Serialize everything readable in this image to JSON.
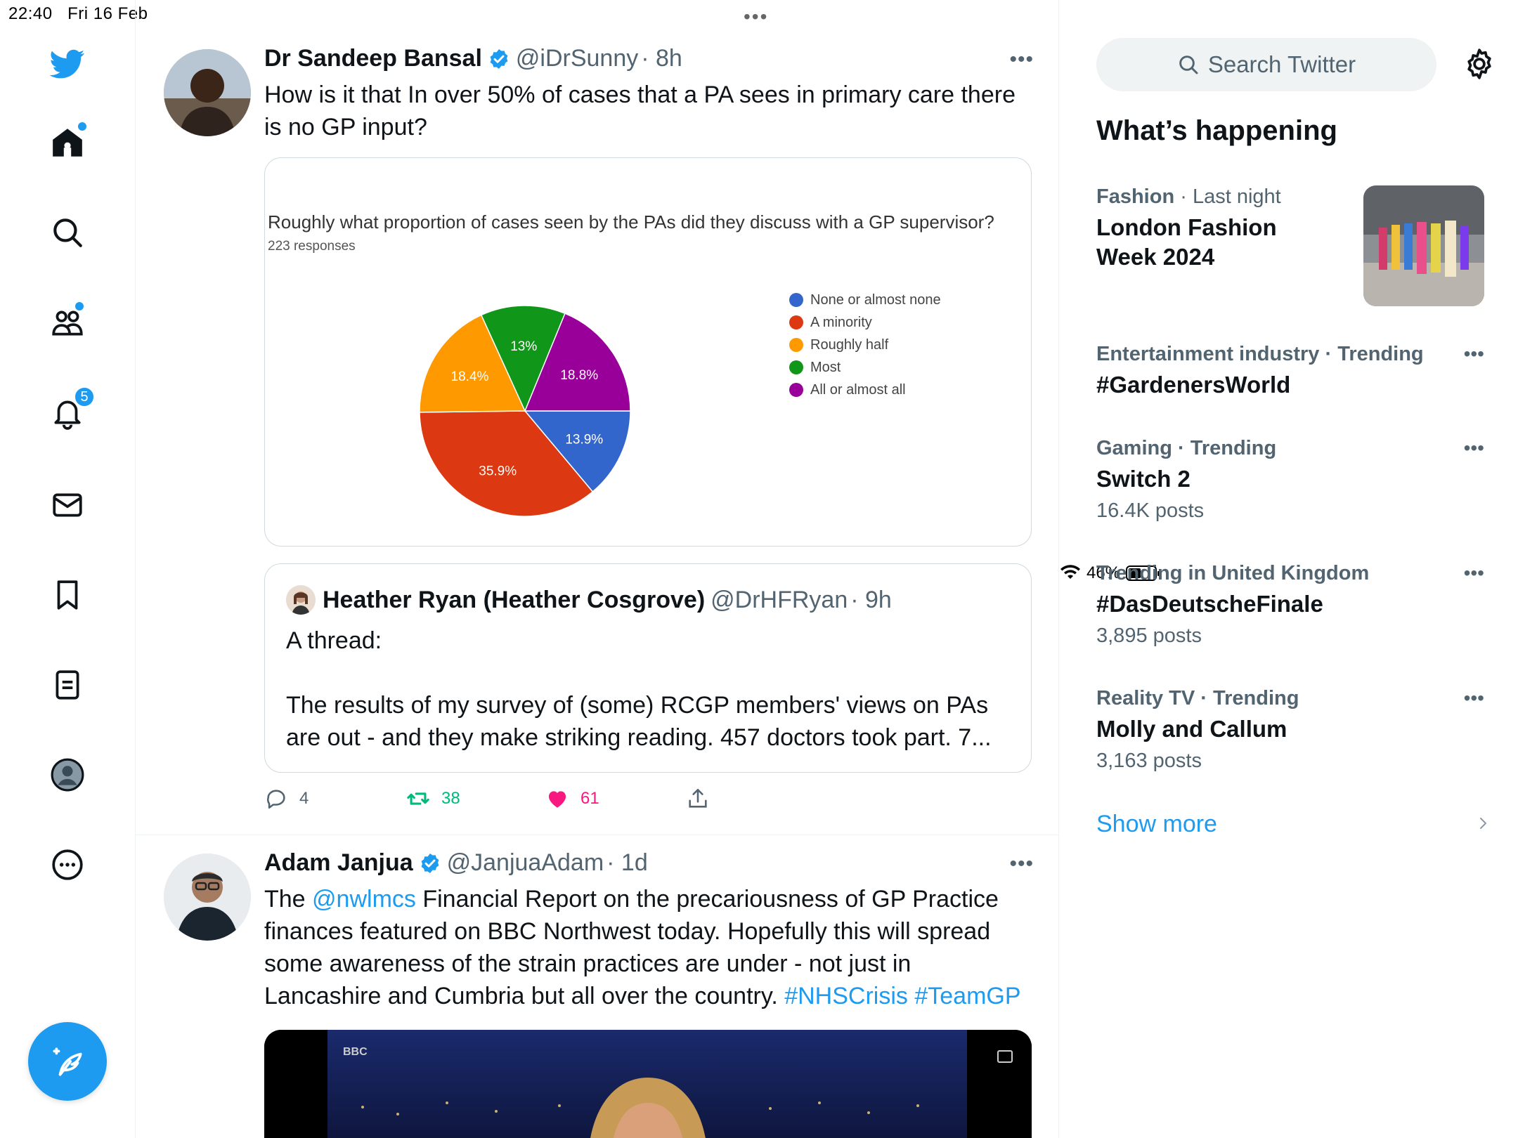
{
  "status_bar": {
    "time": "22:40",
    "date": "Fri 16 Feb",
    "battery": "46%",
    "battery_level": 0.46
  },
  "nav": {
    "notifications_badge": "5"
  },
  "tweets": [
    {
      "name": "Dr Sandeep Bansal",
      "handle": "@iDrSunny",
      "time": "· 8h",
      "text_line1": "How is it that In over 50% of cases that a PA sees in primary care there",
      "text_line2": "is no GP input?",
      "chart_title": "Roughly what proportion of cases seen by the PAs did they discuss with a GP supervisor?",
      "chart_subtitle": "223 responses",
      "quote": {
        "name": "Heather Ryan (Heather Cosgrove)",
        "handle": "@DrHFRyan",
        "time": "· 9h",
        "line1": "A thread:",
        "line2": "The results of my survey of (some) RCGP members' views on PAs",
        "line3": "are out - and they make striking reading. 457 doctors took part. 7..."
      },
      "replies": "4",
      "retweets": "38",
      "likes": "61"
    },
    {
      "name": "Adam Janjua",
      "handle": "@JanjuaAdam",
      "time": "· 1d",
      "text_pre": "The ",
      "mention": "@nwlmcs",
      "text_line1_rest": " Financial Report on the precariousness of GP Practice",
      "text_line2": "finances featured on BBC Northwest today. Hopefully this will spread",
      "text_line3": "some awareness of the strain practices are under - not just in",
      "text_line4_pre": "Lancashire and Cumbria but all over the country. ",
      "hashtags": "#NHSCrisis #TeamGP",
      "media_logo": "BBC"
    }
  ],
  "chart_data": {
    "type": "pie",
    "title": "Roughly what proportion of cases seen by the PAs did they discuss with a GP supervisor?",
    "subtitle": "223 responses",
    "legend_position": "right",
    "slices": [
      {
        "label": "None or almost none",
        "value": 13.9,
        "color": "#3366cc"
      },
      {
        "label": "A minority",
        "value": 35.9,
        "color": "#dc3912"
      },
      {
        "label": "Roughly half",
        "value": 18.4,
        "color": "#ff9900"
      },
      {
        "label": "Most",
        "value": 13.0,
        "color": "#109618"
      },
      {
        "label": "All or almost all",
        "value": 18.8,
        "color": "#990099"
      }
    ],
    "data_labels": [
      "13.9%",
      "35.9%",
      "18.4%",
      "13%",
      "18.8%"
    ]
  },
  "sidebar": {
    "search_placeholder": "Search Twitter",
    "section_title": "What’s happening",
    "trends": [
      {
        "category": "Fashion",
        "context": " · Last night",
        "title_line1": "London Fashion",
        "title_line2": "Week 2024",
        "count": ""
      },
      {
        "category": "Entertainment industry · Trending",
        "context": "",
        "title_line1": "#GardenersWorld",
        "title_line2": "",
        "count": ""
      },
      {
        "category": "Gaming · Trending",
        "context": "",
        "title_line1": "Switch 2",
        "title_line2": "",
        "count": "16.4K posts"
      },
      {
        "category": "Trending in United Kingdom",
        "context": "",
        "title_line1": "#DasDeutscheFinale",
        "title_line2": "",
        "count": "3,895 posts"
      },
      {
        "category": "Reality TV · Trending",
        "context": "",
        "title_line1": "Molly and Callum",
        "title_line2": "",
        "count": "3,163 posts"
      }
    ],
    "show_more": "Show more"
  },
  "colors": {
    "accent": "#1d9bf0",
    "retweet": "#00ba7c",
    "like": "#f91880",
    "text": "#0f1419",
    "muted": "#536471"
  }
}
